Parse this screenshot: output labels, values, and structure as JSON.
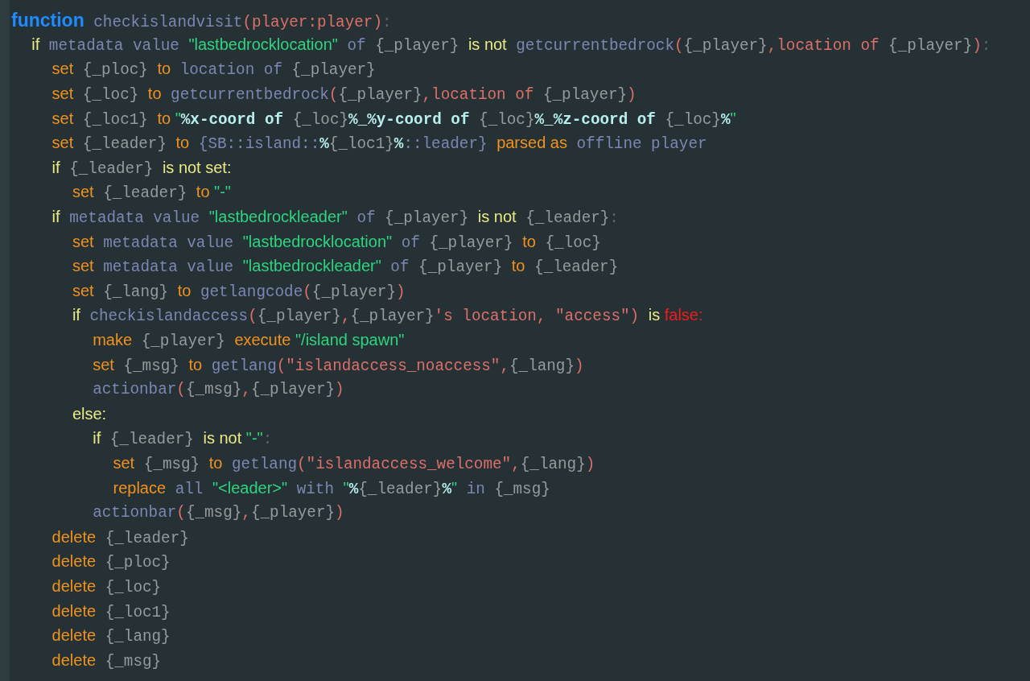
{
  "code": [
    {
      "tokens": [
        {
          "t": "function",
          "kind": "kw"
        },
        {
          "t": " checkislandvisit",
          "kind": "fn"
        },
        {
          "t": "(player:player)",
          "kind": "arg"
        },
        {
          "t": ":",
          "kind": "punct"
        }
      ],
      "children": [
        {
          "tokens": [
            {
              "t": "if",
              "kind": "cond"
            },
            {
              "t": " metadata value ",
              "kind": "fn"
            },
            {
              "t": "\"lastbedrocklocation\"",
              "kind": "str"
            },
            {
              "t": " of ",
              "kind": "fn"
            },
            {
              "t": "{_player} ",
              "kind": "var"
            },
            {
              "t": "is not",
              "kind": "cond"
            },
            {
              "t": " getcurrentbedrock",
              "kind": "fn"
            },
            {
              "t": "(",
              "kind": "arg"
            },
            {
              "t": "{_player}",
              "kind": "var"
            },
            {
              "t": ",location of ",
              "kind": "arg"
            },
            {
              "t": "{_player}",
              "kind": "var"
            },
            {
              "t": ")",
              "kind": "arg"
            },
            {
              "t": ":",
              "kind": "punct"
            }
          ],
          "children": [
            {
              "tokens": [
                {
                  "t": "set",
                  "kind": "act"
                },
                {
                  "t": " {_ploc} ",
                  "kind": "var"
                },
                {
                  "t": "to",
                  "kind": "act"
                },
                {
                  "t": " location of ",
                  "kind": "fn"
                },
                {
                  "t": "{_player}",
                  "kind": "var"
                }
              ]
            },
            {
              "tokens": [
                {
                  "t": "set",
                  "kind": "act"
                },
                {
                  "t": " {_loc} ",
                  "kind": "var"
                },
                {
                  "t": "to",
                  "kind": "act"
                },
                {
                  "t": " getcurrentbedrock",
                  "kind": "fn"
                },
                {
                  "t": "(",
                  "kind": "arg"
                },
                {
                  "t": "{_player}",
                  "kind": "var"
                },
                {
                  "t": ",location of ",
                  "kind": "arg"
                },
                {
                  "t": "{_player}",
                  "kind": "var"
                },
                {
                  "t": ")",
                  "kind": "arg"
                }
              ]
            },
            {
              "tokens": [
                {
                  "t": "set",
                  "kind": "act"
                },
                {
                  "t": " {_loc1} ",
                  "kind": "var"
                },
                {
                  "t": "to",
                  "kind": "act"
                },
                {
                  "t": " \"",
                  "kind": "str"
                },
                {
                  "t": "%x-coord of ",
                  "kind": "cstr"
                },
                {
                  "t": "{_loc}",
                  "kind": "var"
                },
                {
                  "t": "%_%y-coord of ",
                  "kind": "cstr"
                },
                {
                  "t": "{_loc}",
                  "kind": "var"
                },
                {
                  "t": "%_%z-coord of ",
                  "kind": "cstr"
                },
                {
                  "t": "{_loc}",
                  "kind": "var"
                },
                {
                  "t": "%",
                  "kind": "cstr"
                },
                {
                  "t": "\"",
                  "kind": "str"
                }
              ]
            },
            {
              "tokens": [
                {
                  "t": "set",
                  "kind": "act"
                },
                {
                  "t": " {_leader} ",
                  "kind": "var"
                },
                {
                  "t": "to",
                  "kind": "act"
                },
                {
                  "t": " {SB::island::",
                  "kind": "fn"
                },
                {
                  "t": "%",
                  "kind": "cstr"
                },
                {
                  "t": "{_loc1}",
                  "kind": "var"
                },
                {
                  "t": "%",
                  "kind": "cstr"
                },
                {
                  "t": "::leader} ",
                  "kind": "fn"
                },
                {
                  "t": "parsed as",
                  "kind": "act"
                },
                {
                  "t": " offline player",
                  "kind": "fn"
                }
              ]
            },
            {
              "tokens": [
                {
                  "t": "if",
                  "kind": "cond"
                },
                {
                  "t": " {_leader} ",
                  "kind": "var"
                },
                {
                  "t": "is not set:",
                  "kind": "cond"
                }
              ],
              "children": [
                {
                  "tokens": [
                    {
                      "t": "set",
                      "kind": "act"
                    },
                    {
                      "t": " {_leader} ",
                      "kind": "var"
                    },
                    {
                      "t": "to",
                      "kind": "act"
                    },
                    {
                      "t": " \"-\"",
                      "kind": "str"
                    }
                  ]
                }
              ]
            },
            {
              "tokens": [
                {
                  "t": "if",
                  "kind": "cond"
                },
                {
                  "t": " metadata value ",
                  "kind": "fn"
                },
                {
                  "t": "\"lastbedrockleader\"",
                  "kind": "str"
                },
                {
                  "t": " of ",
                  "kind": "fn"
                },
                {
                  "t": "{_player} ",
                  "kind": "var"
                },
                {
                  "t": "is not",
                  "kind": "cond"
                },
                {
                  "t": " {_leader}",
                  "kind": "var"
                },
                {
                  "t": ":",
                  "kind": "punct"
                }
              ],
              "children": [
                {
                  "tokens": [
                    {
                      "t": "set",
                      "kind": "act"
                    },
                    {
                      "t": " metadata value ",
                      "kind": "fn"
                    },
                    {
                      "t": "\"lastbedrocklocation\"",
                      "kind": "str"
                    },
                    {
                      "t": " of ",
                      "kind": "fn"
                    },
                    {
                      "t": "{_player} ",
                      "kind": "var"
                    },
                    {
                      "t": "to",
                      "kind": "act"
                    },
                    {
                      "t": " {_loc}",
                      "kind": "var"
                    }
                  ]
                },
                {
                  "tokens": [
                    {
                      "t": "set",
                      "kind": "act"
                    },
                    {
                      "t": " metadata value ",
                      "kind": "fn"
                    },
                    {
                      "t": "\"lastbedrockleader\"",
                      "kind": "str"
                    },
                    {
                      "t": " of ",
                      "kind": "fn"
                    },
                    {
                      "t": "{_player} ",
                      "kind": "var"
                    },
                    {
                      "t": "to",
                      "kind": "act"
                    },
                    {
                      "t": " {_leader}",
                      "kind": "var"
                    }
                  ]
                },
                {
                  "tokens": [
                    {
                      "t": "set",
                      "kind": "act"
                    },
                    {
                      "t": " {_lang} ",
                      "kind": "var"
                    },
                    {
                      "t": "to",
                      "kind": "act"
                    },
                    {
                      "t": " getlangcode",
                      "kind": "fn"
                    },
                    {
                      "t": "(",
                      "kind": "arg"
                    },
                    {
                      "t": "{_player}",
                      "kind": "var"
                    },
                    {
                      "t": ")",
                      "kind": "arg"
                    }
                  ]
                },
                {
                  "tokens": [
                    {
                      "t": "if",
                      "kind": "cond"
                    },
                    {
                      "t": " checkislandaccess",
                      "kind": "fn"
                    },
                    {
                      "t": "(",
                      "kind": "arg"
                    },
                    {
                      "t": "{_player}",
                      "kind": "var"
                    },
                    {
                      "t": ",",
                      "kind": "arg"
                    },
                    {
                      "t": "{_player}",
                      "kind": "var"
                    },
                    {
                      "t": "'s location, \"access\") ",
                      "kind": "arg"
                    },
                    {
                      "t": "is",
                      "kind": "cond"
                    },
                    {
                      "t": " false:",
                      "kind": "bool"
                    }
                  ],
                  "children": [
                    {
                      "tokens": [
                        {
                          "t": "make",
                          "kind": "act"
                        },
                        {
                          "t": " {_player} ",
                          "kind": "var"
                        },
                        {
                          "t": "execute",
                          "kind": "act"
                        },
                        {
                          "t": " \"/island spawn\"",
                          "kind": "str"
                        }
                      ]
                    },
                    {
                      "tokens": [
                        {
                          "t": "set",
                          "kind": "act"
                        },
                        {
                          "t": " {_msg} ",
                          "kind": "var"
                        },
                        {
                          "t": "to",
                          "kind": "act"
                        },
                        {
                          "t": " getlang",
                          "kind": "fn"
                        },
                        {
                          "t": "(\"islandaccess_noaccess\",",
                          "kind": "arg"
                        },
                        {
                          "t": "{_lang}",
                          "kind": "var"
                        },
                        {
                          "t": ")",
                          "kind": "arg"
                        }
                      ]
                    },
                    {
                      "tokens": [
                        {
                          "t": "actionbar",
                          "kind": "fn"
                        },
                        {
                          "t": "(",
                          "kind": "arg"
                        },
                        {
                          "t": "{_msg}",
                          "kind": "var"
                        },
                        {
                          "t": ",",
                          "kind": "arg"
                        },
                        {
                          "t": "{_player}",
                          "kind": "var"
                        },
                        {
                          "t": ")",
                          "kind": "arg"
                        }
                      ]
                    }
                  ]
                },
                {
                  "tokens": [
                    {
                      "t": "else:",
                      "kind": "cond"
                    }
                  ],
                  "children": [
                    {
                      "tokens": [
                        {
                          "t": "if",
                          "kind": "cond"
                        },
                        {
                          "t": " {_leader} ",
                          "kind": "var"
                        },
                        {
                          "t": "is not",
                          "kind": "cond"
                        },
                        {
                          "t": " \"-\"",
                          "kind": "str"
                        },
                        {
                          "t": ":",
                          "kind": "punct"
                        }
                      ],
                      "children": [
                        {
                          "tokens": [
                            {
                              "t": "set",
                              "kind": "act"
                            },
                            {
                              "t": " {_msg} ",
                              "kind": "var"
                            },
                            {
                              "t": "to",
                              "kind": "act"
                            },
                            {
                              "t": " getlang",
                              "kind": "fn"
                            },
                            {
                              "t": "(\"islandaccess_welcome\",",
                              "kind": "arg"
                            },
                            {
                              "t": "{_lang}",
                              "kind": "var"
                            },
                            {
                              "t": ")",
                              "kind": "arg"
                            }
                          ]
                        },
                        {
                          "tokens": [
                            {
                              "t": "replace",
                              "kind": "act"
                            },
                            {
                              "t": " all ",
                              "kind": "fn"
                            },
                            {
                              "t": "\"<leader>\"",
                              "kind": "str"
                            },
                            {
                              "t": " with ",
                              "kind": "fn"
                            },
                            {
                              "t": "\"",
                              "kind": "str"
                            },
                            {
                              "t": "%",
                              "kind": "cstr"
                            },
                            {
                              "t": "{_leader}",
                              "kind": "var"
                            },
                            {
                              "t": "%",
                              "kind": "cstr"
                            },
                            {
                              "t": "\"",
                              "kind": "str"
                            },
                            {
                              "t": " in ",
                              "kind": "fn"
                            },
                            {
                              "t": "{_msg}",
                              "kind": "var"
                            }
                          ]
                        }
                      ]
                    },
                    {
                      "tokens": [
                        {
                          "t": "actionbar",
                          "kind": "fn"
                        },
                        {
                          "t": "(",
                          "kind": "arg"
                        },
                        {
                          "t": "{_msg}",
                          "kind": "var"
                        },
                        {
                          "t": ",",
                          "kind": "arg"
                        },
                        {
                          "t": "{_player}",
                          "kind": "var"
                        },
                        {
                          "t": ")",
                          "kind": "arg"
                        }
                      ]
                    }
                  ]
                }
              ]
            },
            {
              "tokens": [
                {
                  "t": "delete",
                  "kind": "act"
                },
                {
                  "t": " {_leader}",
                  "kind": "var"
                }
              ]
            },
            {
              "tokens": [
                {
                  "t": "delete",
                  "kind": "act"
                },
                {
                  "t": " {_ploc}",
                  "kind": "var"
                }
              ]
            },
            {
              "tokens": [
                {
                  "t": "delete",
                  "kind": "act"
                },
                {
                  "t": " {_loc}",
                  "kind": "var"
                }
              ]
            },
            {
              "tokens": [
                {
                  "t": "delete",
                  "kind": "act"
                },
                {
                  "t": " {_loc1}",
                  "kind": "var"
                }
              ]
            },
            {
              "tokens": [
                {
                  "t": "delete",
                  "kind": "act"
                },
                {
                  "t": " {_lang}",
                  "kind": "var"
                }
              ]
            },
            {
              "tokens": [
                {
                  "t": "delete",
                  "kind": "act"
                },
                {
                  "t": " {_msg}",
                  "kind": "var"
                }
              ]
            }
          ]
        }
      ]
    }
  ]
}
